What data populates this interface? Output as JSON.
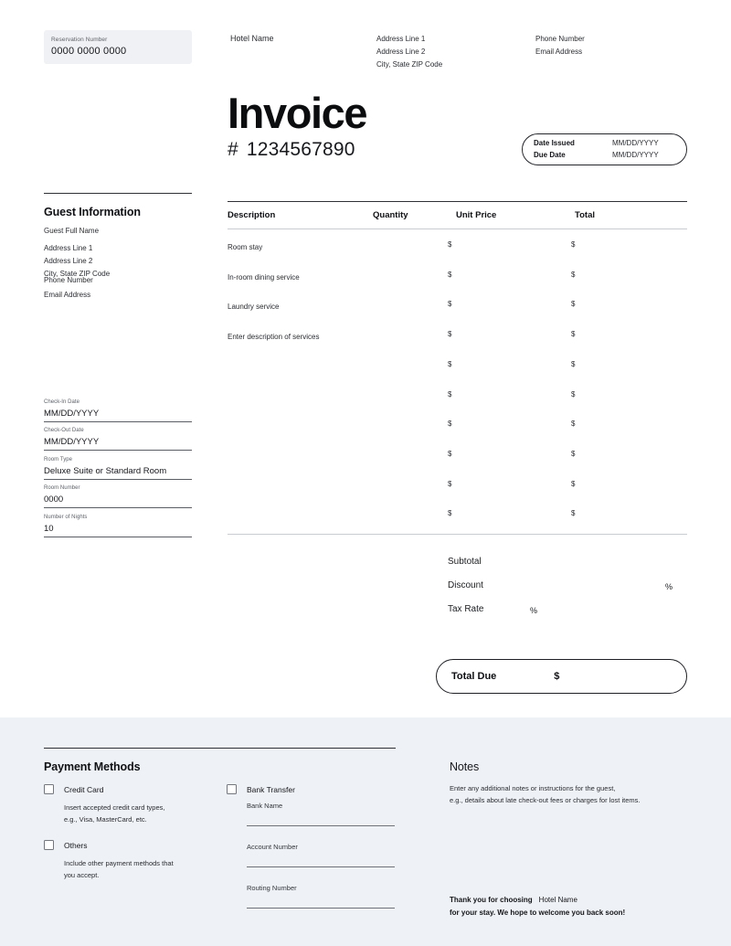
{
  "header": {
    "reservation_label": "Reservation Number",
    "reservation_value": "0000 0000 0000",
    "hotel_name": "Hotel Name",
    "address_line_1": "Address Line 1",
    "address_line_2": "Address Line 2",
    "address_city": "City, State ZIP Code",
    "phone": "Phone Number",
    "email": "Email Address"
  },
  "invoice": {
    "title": "Invoice",
    "hash": "#",
    "number": "1234567890",
    "date_issued_label": "Date Issued",
    "due_date_label": "Due Date",
    "date_issued_value": "MM/DD/YYYY",
    "due_date_value": "MM/DD/YYYY"
  },
  "guest": {
    "heading": "Guest Information",
    "full_name": "Guest Full Name",
    "address_line_1": "Address Line 1",
    "address_line_2": "Address Line 2",
    "address_city": "City, State ZIP Code",
    "phone": "Phone Number",
    "email": "Email Address"
  },
  "stay_fields": [
    {
      "label": "Check-In Date",
      "value": "MM/DD/YYYY"
    },
    {
      "label": "Check-Out Date",
      "value": "MM/DD/YYYY"
    },
    {
      "label": "Room Type",
      "value": "Deluxe Suite or Standard Room"
    },
    {
      "label": "Room Number",
      "value": "0000"
    },
    {
      "label": "Number of Nights",
      "value": "10"
    }
  ],
  "table": {
    "columns": {
      "description": "Description",
      "quantity": "Quantity",
      "unit_price": "Unit Price",
      "total": "Total"
    },
    "rows": [
      {
        "description": "Room stay",
        "quantity": "",
        "unit_price": "$",
        "total": "$"
      },
      {
        "description": "In-room dining service",
        "quantity": "",
        "unit_price": "$",
        "total": "$"
      },
      {
        "description": "Laundry service",
        "quantity": "",
        "unit_price": "$",
        "total": "$"
      },
      {
        "description": "Enter description of services",
        "quantity": "",
        "unit_price": "$",
        "total": "$"
      },
      {
        "description": "",
        "quantity": "",
        "unit_price": "$",
        "total": "$"
      },
      {
        "description": "",
        "quantity": "",
        "unit_price": "$",
        "total": "$"
      },
      {
        "description": "",
        "quantity": "",
        "unit_price": "$",
        "total": "$"
      },
      {
        "description": "",
        "quantity": "",
        "unit_price": "$",
        "total": "$"
      },
      {
        "description": "",
        "quantity": "",
        "unit_price": "$",
        "total": "$"
      },
      {
        "description": "",
        "quantity": "",
        "unit_price": "$",
        "total": "$"
      }
    ]
  },
  "summary": {
    "subtotal_label": "Subtotal",
    "subtotal_value": "",
    "discount_label": "Discount",
    "discount_percent": "%",
    "tax_label": "Tax Rate",
    "tax_percent": "%",
    "total_due_label": "Total Due",
    "total_due_value": "$"
  },
  "payment": {
    "heading": "Payment Methods",
    "credit_card_label": "Credit Card",
    "credit_card_help": "Insert accepted credit card types,\ne.g., Visa, MasterCard, etc.",
    "others_label": "Others",
    "others_help": "Include other payment methods that\nyou accept.",
    "bank_transfer_label": "Bank Transfer",
    "bank_name_label": "Bank Name",
    "account_number_label": "Account Number",
    "routing_number_label": "Routing Number"
  },
  "notes": {
    "heading": "Notes",
    "body": "Enter any additional notes or instructions for the guest,\ne.g., details about late check-out fees or charges for lost items.",
    "thanks_prefix": "Thank you for choosing",
    "thanks_hotel": "Hotel Name",
    "thanks_suffix": "for your stay. We hope to welcome you back soon!"
  },
  "colors": {
    "footer_band": "#eef1f5",
    "reservation_box": "#f0f1f4",
    "ink": "#15161a",
    "rule_dark": "#2e3035",
    "rule_light": "#c9ccd1"
  }
}
